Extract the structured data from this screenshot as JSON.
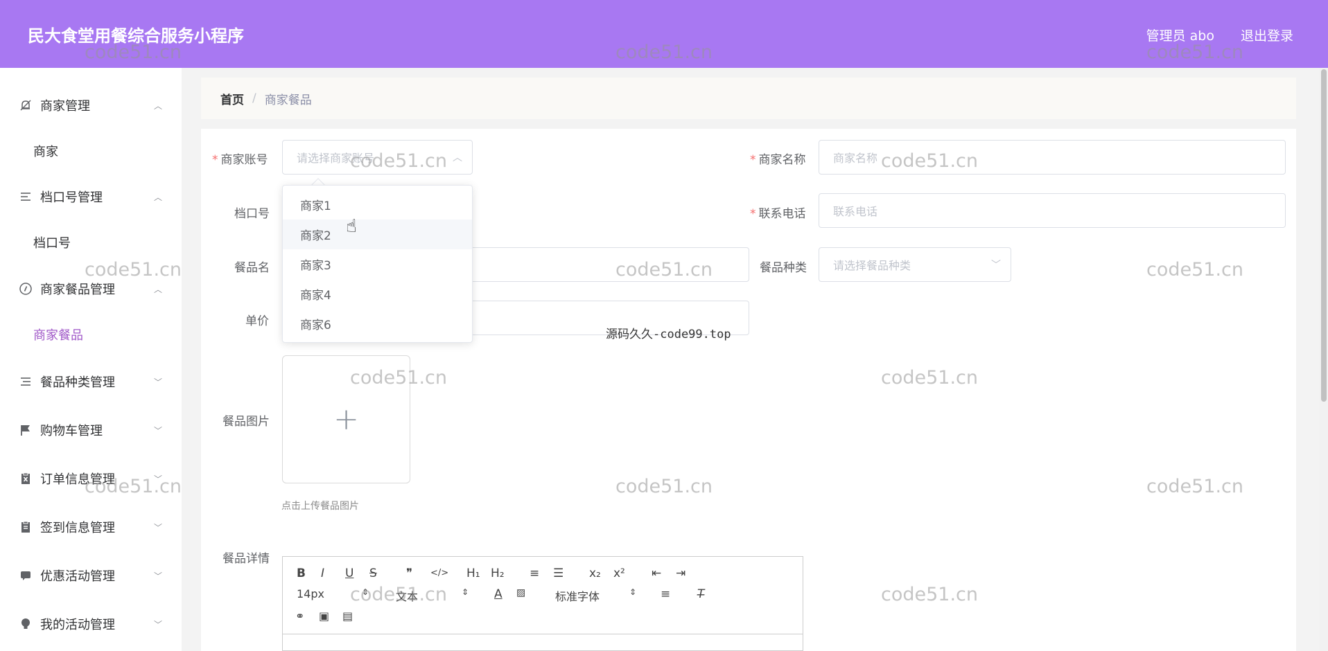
{
  "header": {
    "app_title": "民大食堂用餐综合服务小程序",
    "user_info": "管理员 abo",
    "logout_label": "退出登录"
  },
  "sidebar": {
    "items": [
      {
        "label": "商家管理",
        "icon": "bell-off-icon",
        "expanded": true,
        "sub": [
          "商家"
        ]
      },
      {
        "label": "档口号管理",
        "icon": "list-icon",
        "expanded": true,
        "sub": [
          "档口号"
        ]
      },
      {
        "label": "商家餐品管理",
        "icon": "compass-icon",
        "expanded": true,
        "sub": [
          "商家餐品"
        ]
      },
      {
        "label": "餐品种类管理",
        "icon": "list-icon",
        "expanded": false
      },
      {
        "label": "购物车管理",
        "icon": "flag-icon",
        "expanded": false
      },
      {
        "label": "订单信息管理",
        "icon": "clipboard-x-icon",
        "expanded": false
      },
      {
        "label": "签到信息管理",
        "icon": "clipboard-icon",
        "expanded": false
      },
      {
        "label": "优惠活动管理",
        "icon": "chat-bubble-icon",
        "expanded": false
      },
      {
        "label": "我的活动管理",
        "icon": "bulb-icon",
        "expanded": false
      }
    ],
    "active_sub": "商家餐品"
  },
  "breadcrumb": {
    "home": "首页",
    "separator": "/",
    "current": "商家餐品"
  },
  "form": {
    "merchant_account": {
      "label": "商家账号",
      "placeholder": "请选择商家账号",
      "required": true
    },
    "merchant_name": {
      "label": "商家名称",
      "placeholder": "商家名称",
      "required": true
    },
    "stall_no": {
      "label": "档口号"
    },
    "phone": {
      "label": "联系电话",
      "placeholder": "联系电话",
      "required": true
    },
    "dish_name": {
      "label": "餐品名"
    },
    "dish_category": {
      "label": "餐品种类",
      "placeholder": "请选择餐品种类"
    },
    "unit_price": {
      "label": "单价"
    },
    "dish_image": {
      "label": "餐品图片",
      "tip": "点击上传餐品图片"
    },
    "dish_detail": {
      "label": "餐品详情"
    }
  },
  "dropdown": {
    "options": [
      "商家1",
      "商家2",
      "商家3",
      "商家4",
      "商家6"
    ],
    "hovered": "商家2"
  },
  "editor_toolbar": {
    "row1": [
      "B",
      "I",
      "U",
      "S",
      "❞",
      "</>",
      "H₁",
      "H₂",
      "≡",
      "☰",
      "x₂",
      "x²",
      "⇤",
      "⇥"
    ],
    "font_size": "14px",
    "header_select": "文本",
    "font_select": "标准字体"
  },
  "watermark": {
    "text": "code51.cn",
    "center_text": "源码久久-code99.top"
  }
}
